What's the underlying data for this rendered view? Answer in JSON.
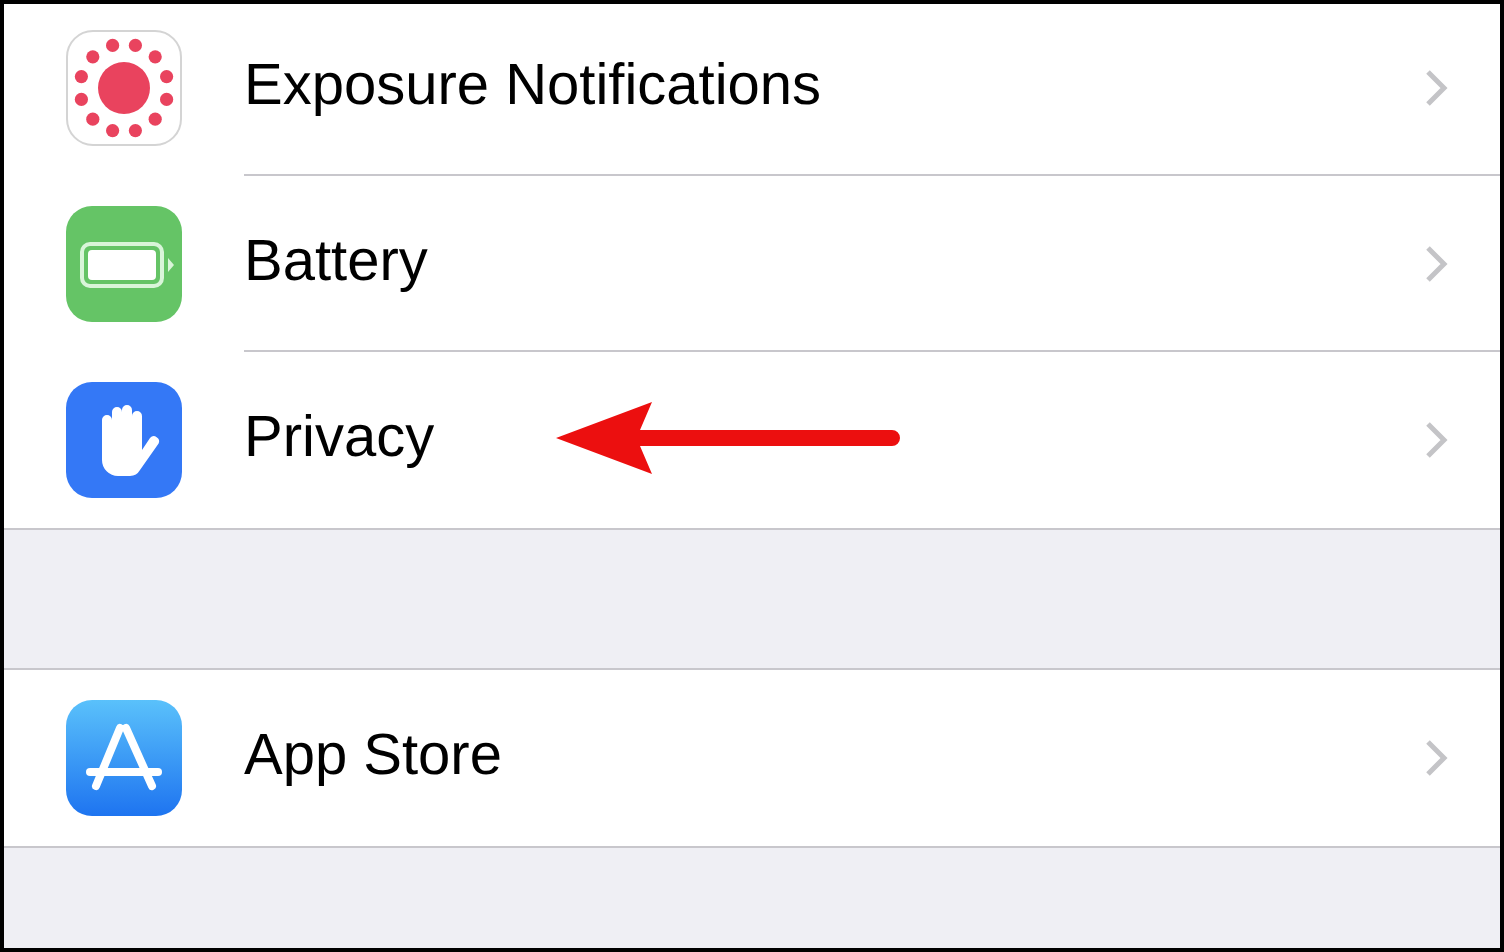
{
  "groups": [
    {
      "rows": [
        {
          "kind": "exposure",
          "label": "Exposure Notifications"
        },
        {
          "kind": "battery",
          "label": "Battery"
        },
        {
          "kind": "privacy",
          "label": "Privacy",
          "highlighted": true
        }
      ]
    },
    {
      "rows": [
        {
          "kind": "appstore",
          "label": "App Store",
          "highlighted": false
        }
      ]
    }
  ]
}
